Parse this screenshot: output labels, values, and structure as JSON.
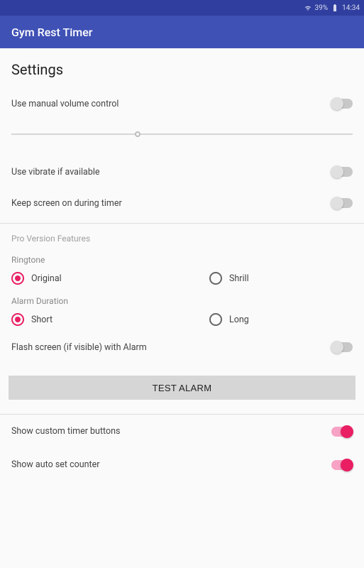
{
  "status": {
    "battery": "39%",
    "time": "14:34"
  },
  "app": {
    "title": "Gym Rest Timer"
  },
  "settings": {
    "page_title": "Settings",
    "manual_volume": {
      "label": "Use manual volume control",
      "on": false
    },
    "vibrate": {
      "label": "Use vibrate if available",
      "on": false
    },
    "keep_screen": {
      "label": "Keep screen on during timer",
      "on": false
    }
  },
  "pro": {
    "header": "Pro Version Features",
    "ringtone_label": "Ringtone",
    "ringtone_options": {
      "original": "Original",
      "shrill": "Shrill"
    },
    "ringtone_selected": "original",
    "duration_label": "Alarm Duration",
    "duration_options": {
      "short": "Short",
      "long": "Long"
    },
    "duration_selected": "short",
    "flash_screen": {
      "label": "Flash screen (if visible) with Alarm",
      "on": false
    },
    "test_alarm": "TEST ALARM",
    "custom_buttons": {
      "label": "Show custom timer buttons",
      "on": true
    },
    "auto_set": {
      "label": "Show auto set counter",
      "on": true
    }
  }
}
